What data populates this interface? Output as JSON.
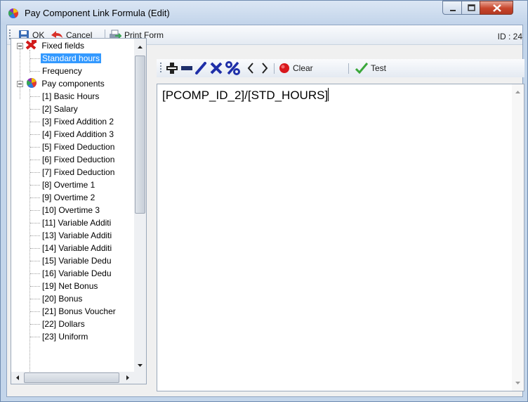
{
  "window": {
    "title": "Pay Component Link Formula (Edit)"
  },
  "toolbar": {
    "ok_label": "OK",
    "cancel_label": "Cancel",
    "print_label": "Print Form",
    "id_text": "ID : 24"
  },
  "tree": {
    "groups": [
      {
        "label": "Fixed fields",
        "icon": "fixed-fields-icon",
        "items": [
          {
            "label": "Standard hours",
            "selected": true
          },
          {
            "label": "Frequency",
            "selected": false
          }
        ]
      },
      {
        "label": "Pay components",
        "icon": "pay-components-icon",
        "items": [
          {
            "label": "[1] Basic Hours"
          },
          {
            "label": "[2] Salary"
          },
          {
            "label": "[3] Fixed Addition 2"
          },
          {
            "label": "[4] Fixed Addition 3"
          },
          {
            "label": "[5] Fixed Deduction"
          },
          {
            "label": "[6] Fixed Deduction"
          },
          {
            "label": "[7] Fixed Deduction"
          },
          {
            "label": "[8] Overtime 1"
          },
          {
            "label": "[9] Overtime 2"
          },
          {
            "label": "[10] Overtime 3"
          },
          {
            "label": "[11] Variable Additi"
          },
          {
            "label": "[13] Variable Additi"
          },
          {
            "label": "[14] Variable Additi"
          },
          {
            "label": "[15] Variable Dedu"
          },
          {
            "label": "[16] Variable Dedu"
          },
          {
            "label": "[19] Net Bonus"
          },
          {
            "label": "[20] Bonus"
          },
          {
            "label": "[21] Bonus Voucher"
          },
          {
            "label": "[22] Dollars"
          },
          {
            "label": "[23] Uniform"
          }
        ]
      }
    ]
  },
  "formula_toolbar": {
    "operators": [
      "+",
      "-",
      "/",
      "x",
      "%",
      "(",
      ")"
    ],
    "clear_label": "Clear",
    "test_label": "Test"
  },
  "editor": {
    "formula": "[PCOMP_ID_2]/[STD_HOURS]"
  },
  "colors": {
    "selection": "#3399ff",
    "close_button": "#c7452b"
  }
}
